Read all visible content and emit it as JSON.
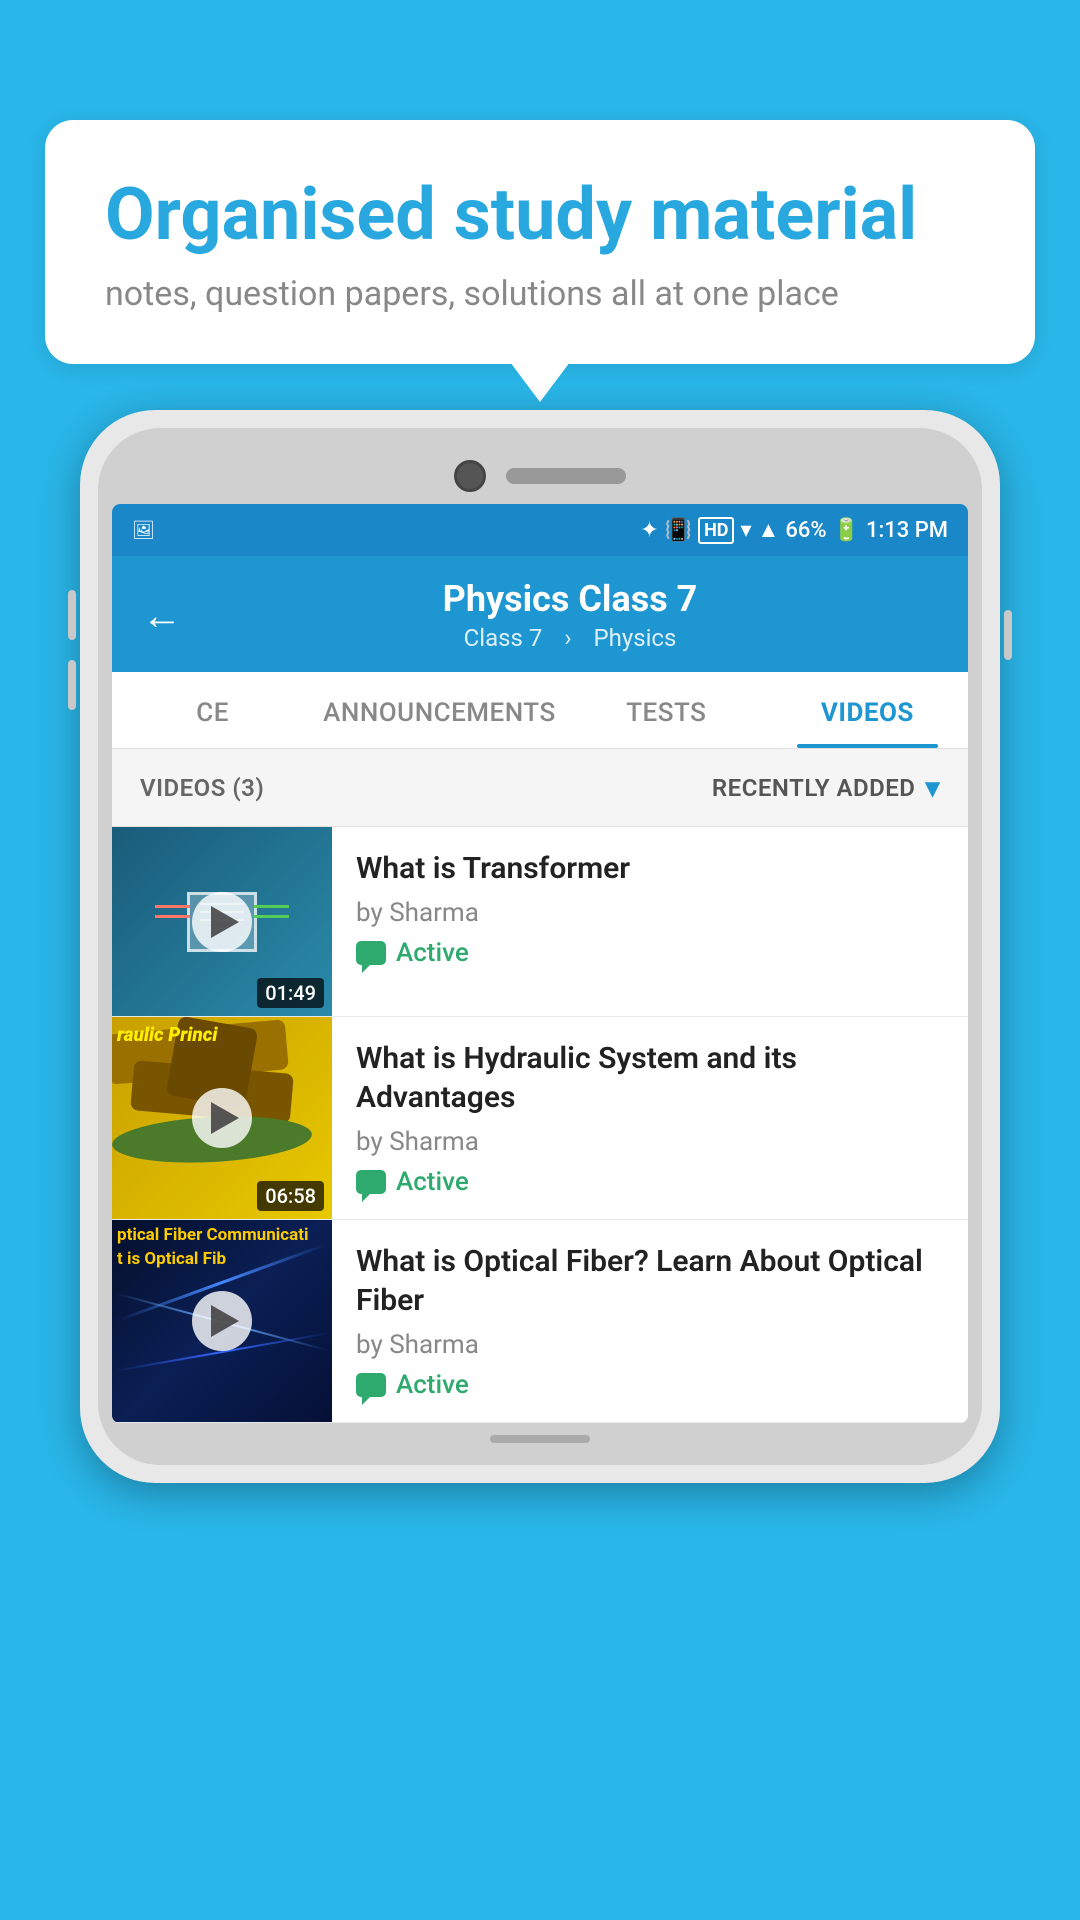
{
  "background_color": "#29b6e8",
  "speech_bubble": {
    "title": "Organised study material",
    "subtitle": "notes, question papers, solutions all at one place"
  },
  "status_bar": {
    "time": "1:13 PM",
    "battery": "66%",
    "signal_icons": "HD"
  },
  "app_header": {
    "title": "Physics Class 7",
    "breadcrumb1": "Class 7",
    "breadcrumb2": "Physics",
    "back_label": "←"
  },
  "tabs": [
    {
      "label": "CE",
      "active": false
    },
    {
      "label": "ANNOUNCEMENTS",
      "active": false
    },
    {
      "label": "TESTS",
      "active": false
    },
    {
      "label": "VIDEOS",
      "active": true
    }
  ],
  "filter_bar": {
    "count_label": "VIDEOS (3)",
    "sort_label": "RECENTLY ADDED"
  },
  "videos": [
    {
      "title": "What is  Transformer",
      "author": "by Sharma",
      "status": "Active",
      "duration": "01:49",
      "thumbnail_type": "transformer"
    },
    {
      "title": "What is Hydraulic System and its Advantages",
      "author": "by Sharma",
      "status": "Active",
      "duration": "06:58",
      "thumbnail_type": "hydraulic",
      "thumbnail_text": "raulic Princi"
    },
    {
      "title": "What is Optical Fiber? Learn About Optical Fiber",
      "author": "by Sharma",
      "status": "Active",
      "duration": "",
      "thumbnail_type": "optical",
      "thumbnail_text_line1": "ptical Fiber Communicati",
      "thumbnail_text_line2": "t is Optical Fib"
    }
  ]
}
